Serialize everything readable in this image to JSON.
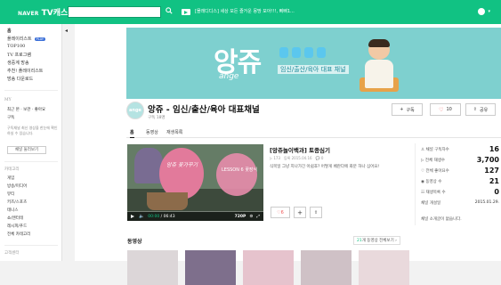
{
  "topbar": {
    "brand_naver": "NAVER",
    "brand_tv": "TV캐스트",
    "search_placeholder": "",
    "search_icon": "search-icon",
    "marquee": "[몰래디디스] 세상 모든 즐거운 몽땅 모아!!!, 삐삐1...",
    "colors": {
      "accent": "#11c283"
    }
  },
  "sidebar": {
    "items": [
      {
        "label": "홈"
      },
      {
        "label": "플레이리스트",
        "badge": "PLAY"
      },
      {
        "label": "TOP100"
      },
      {
        "label": "TV 프로그램"
      },
      {
        "label": "생중계 방송"
      },
      {
        "label": "추천! 플레이리스트"
      },
      {
        "label": "방송 다운로드"
      }
    ],
    "my_head": "MY",
    "my_links": "최근 본 · 보관 · 좋아요",
    "my_sub": "구독",
    "my_info": "구독채널 최신 영상을 한눈에 확인하실 수 있습니다.",
    "login_btn": "채널 둘러보기",
    "category_head": "카테고리",
    "categories": [
      {
        "label": "게임"
      },
      {
        "label": "방송/미디어"
      },
      {
        "label": "뷰티"
      },
      {
        "label": "키즈/스포츠"
      },
      {
        "label": "테니스"
      },
      {
        "label": "쇼/엔터테"
      },
      {
        "label": "레시피/푸드"
      },
      {
        "label": "전체 카테고리"
      }
    ],
    "footer": "고객센터"
  },
  "banner": {
    "logo_word": "앙쥬",
    "logo_sub": "ange",
    "tagline": "임신/출산/육아 대표 채널"
  },
  "channel": {
    "logo_text": "ange",
    "name": "앙쥬 - 임신/출산/육아 대표채널",
    "subscribers": "구독 18명",
    "subscribe_label": "구독",
    "like_count": "10",
    "share_label": "공유"
  },
  "tabs": [
    {
      "label": "홈"
    },
    {
      "label": "동영상"
    },
    {
      "label": "재생목록"
    }
  ],
  "player": {
    "sign_text": "앙쥬 꽃가꾸기",
    "lesson_text": "LESSON 6 꽃장식",
    "time_current": "00:00",
    "time_total": "06:43",
    "quality": "720P",
    "progress": 0.0
  },
  "video": {
    "title": "[앙쥬놀이백과] 토종심기",
    "plays": "173",
    "date": "2015.04.16",
    "comments": "0",
    "description": "식목일 그냥 지나가긴 아쉽죠? 어떻게 베란다에 화분 하나 심어요!",
    "like_count": "6"
  },
  "stats": {
    "rows": [
      {
        "label": "채널 구독자수",
        "value": "16"
      },
      {
        "label": "전체 재생수",
        "value": "3,700"
      },
      {
        "label": "전체 좋아요수",
        "value": "127"
      },
      {
        "label": "동영상 수",
        "value": "21"
      },
      {
        "label": "재생목록 수",
        "value": "0"
      }
    ],
    "opened_label": "채널 개설일",
    "opened_value": "2015.01.29.",
    "intro": "채널 소개글이 없습니다."
  },
  "video_list": {
    "title": "동영상",
    "all_count": "21",
    "all_label": "개 동영상 전체보기"
  }
}
